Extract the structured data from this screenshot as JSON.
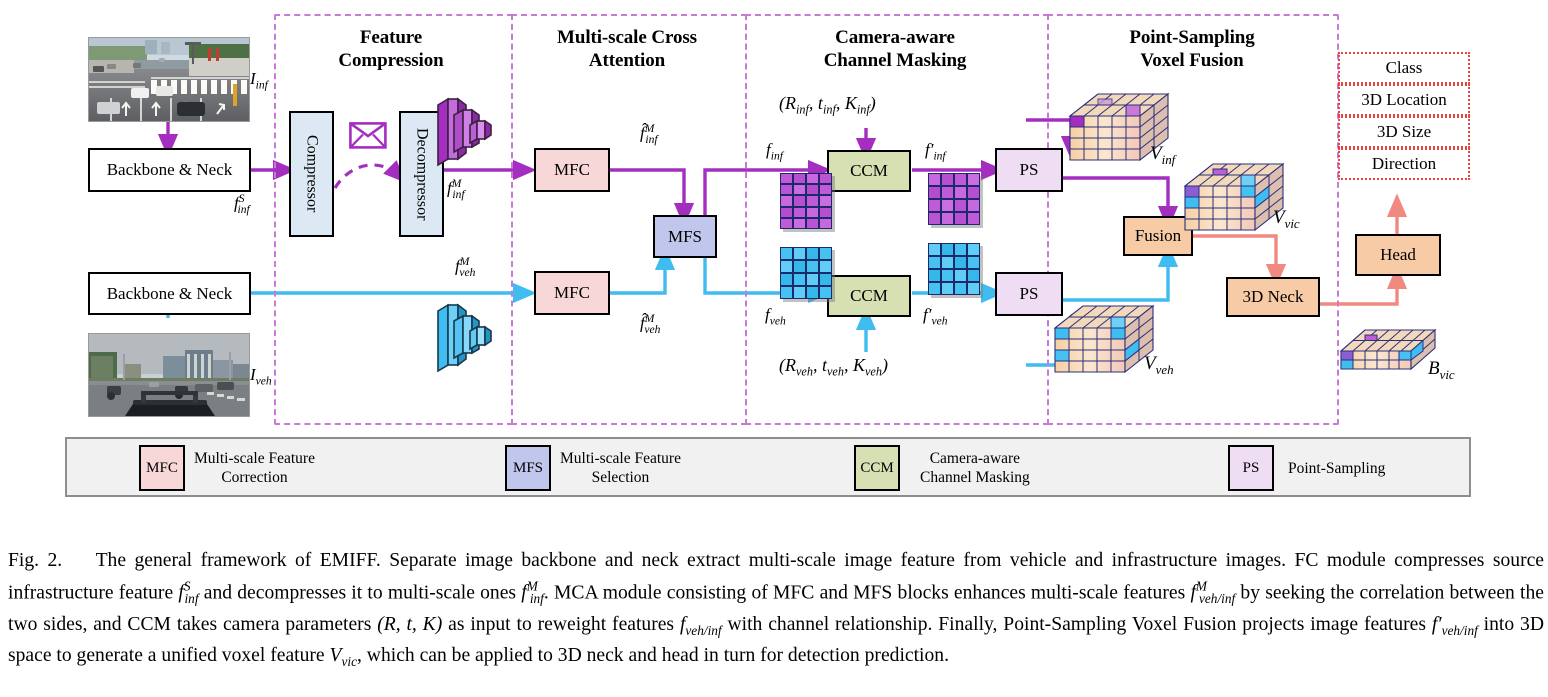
{
  "figure": {
    "caption_number": "Fig. 2.",
    "caption": "The general framework of EMIFF. Separate image backbone and neck extract multi-scale image feature from vehicle and infrastructure images. FC module compresses source infrastructure feature f S inf and decompresses it to multi-scale ones f M inf. MCA module consisting of MFC and MFS blocks enhances multi-scale features f M veh/inf by seeking the correlation between the two sides, and CCM takes camera parameters (R, t, K) as input to reweight features f veh/inf with channel relationship. Finally, Point-Sampling Voxel Fusion projects image features f′ veh/inf into 3D space to generate a unified voxel feature V vic, which can be applied to 3D neck and head in turn for detection prediction."
  },
  "modules": [
    {
      "id": "fc",
      "title_line1": "Feature",
      "title_line2": "Compression"
    },
    {
      "id": "mca",
      "title_line1": "Multi-scale Cross",
      "title_line2": "Attention"
    },
    {
      "id": "ccm",
      "title_line1": "Camera-aware",
      "title_line2": "Channel Masking"
    },
    {
      "id": "psvf",
      "title_line1": "Point-Sampling",
      "title_line2": "Voxel Fusion"
    }
  ],
  "blocks": {
    "backbone_inf": "Backbone & Neck",
    "backbone_veh": "Backbone & Neck",
    "compressor": "Compressor",
    "decompressor": "Decompressor",
    "mfc_inf": "MFC",
    "mfc_veh": "MFC",
    "mfs": "MFS",
    "ccm_inf": "CCM",
    "ccm_veh": "CCM",
    "ps_inf": "PS",
    "ps_veh": "PS",
    "fusion": "Fusion",
    "neck3d": "3D Neck",
    "head": "Head"
  },
  "signal_labels": {
    "i_inf": "I",
    "i_inf_sub": "inf",
    "i_veh": "I",
    "i_veh_sub": "veh",
    "f_inf_s": "f",
    "f_inf_s_sub": "inf",
    "f_inf_s_sup": "S",
    "f_inf_m": "f",
    "f_inf_m_sub": "inf",
    "f_inf_m_sup": "M",
    "f_veh_m": "f",
    "f_veh_m_sub": "veh",
    "f_veh_m_sup": "M",
    "fhat_inf_m": "f̂",
    "fhat_inf_m_sub": "inf",
    "fhat_inf_m_sup": "M",
    "fhat_veh_m": "f̂",
    "fhat_veh_m_sub": "veh",
    "fhat_veh_m_sup": "M",
    "f_inf": "f",
    "f_inf_sub": "inf",
    "f_veh": "f",
    "f_veh_sub": "veh",
    "fp_inf": "f′",
    "fp_inf_sub": "inf",
    "fp_veh": "f′",
    "fp_veh_sub": "veh",
    "cam_inf": "(R inf , t inf , K inf )",
    "cam_veh": "(R veh , t veh , K veh )",
    "v_inf": "V",
    "v_inf_sub": "inf",
    "v_veh": "V",
    "v_veh_sub": "veh",
    "v_vic": "V",
    "v_vic_sub": "vic",
    "b_vic": "B",
    "b_vic_sub": "vic"
  },
  "camera_params": {
    "inf": {
      "R": "R",
      "R_sub": "inf",
      "t": "t",
      "t_sub": "inf",
      "K": "K",
      "K_sub": "inf"
    },
    "veh": {
      "R": "R",
      "R_sub": "veh",
      "t": "t",
      "t_sub": "veh",
      "K": "K",
      "K_sub": "veh"
    }
  },
  "outputs": [
    "Class",
    "3D Location",
    "3D Size",
    "Direction"
  ],
  "legend": [
    {
      "chip": "MFC",
      "line1": "Multi-scale Feature",
      "line2": "Correction",
      "color": "#f7d7d8"
    },
    {
      "chip": "MFS",
      "line1": "Multi-scale Feature",
      "line2": "Selection",
      "color": "#c0c6ec"
    },
    {
      "chip": "CCM",
      "line1": "Camera-aware",
      "line2": "Channel Masking",
      "color": "#d6e0b2"
    },
    {
      "chip": "PS",
      "line1": "Point-Sampling",
      "line2": "",
      "color": "#efddf3"
    }
  ],
  "colors": {
    "inf_stream": "#a32ec0",
    "veh_stream": "#3fbcf0",
    "fusion_stream": "#f08a80",
    "module_frame": "#c77ad6",
    "output_box": "#e8453c",
    "mfc_fill": "#f7d7d8",
    "mfs_fill": "#c0c6ec",
    "ccm_fill": "#d6e0b2",
    "ps_fill": "#efddf3",
    "orange_fill": "#f7cba6",
    "compressor_fill": "#dce9f5"
  }
}
